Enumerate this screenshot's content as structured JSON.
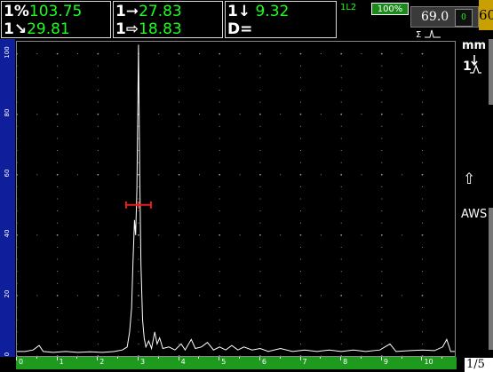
{
  "readings": {
    "r1": {
      "sym": "1%",
      "value": "103.75"
    },
    "r2": {
      "sym": "1↘",
      "value": "29.81"
    },
    "r3": {
      "sym": "1➞",
      "value": "27.83"
    },
    "r4": {
      "sym": "1⇨",
      "value": "18.83"
    },
    "r5": {
      "sym": "1↓",
      "value": "9.32"
    },
    "r6": {
      "label": "D="
    }
  },
  "status": {
    "gate_indicator": "1L2",
    "battery": "100%",
    "gain": "69.0",
    "gain_step_indicator": "0",
    "gain_step": "60",
    "mode_icon": "sigma-rectify-icon"
  },
  "sidebar": {
    "unit": "mm",
    "up_arrow": "⇧",
    "aws": "AWS"
  },
  "page_indicator": "1/5",
  "axes": {
    "y_ticks": [
      "100",
      "80",
      "60",
      "40",
      "20",
      "0"
    ],
    "x_ticks": [
      "0",
      "1",
      "2",
      "3",
      "4",
      "5",
      "6",
      "7",
      "8",
      "9",
      "10"
    ]
  },
  "waveform": {
    "units": "percent screen height vs screen division",
    "x_range": [
      0,
      10.8
    ],
    "y_range": [
      0,
      104
    ],
    "points": [
      [
        0.0,
        1.5
      ],
      [
        0.2,
        1.5
      ],
      [
        0.4,
        2
      ],
      [
        0.55,
        3.5
      ],
      [
        0.65,
        1.5
      ],
      [
        0.9,
        1.2
      ],
      [
        1.2,
        1.5
      ],
      [
        1.5,
        1.2
      ],
      [
        1.8,
        1.4
      ],
      [
        2.1,
        1.2
      ],
      [
        2.4,
        1.5
      ],
      [
        2.6,
        2
      ],
      [
        2.72,
        3
      ],
      [
        2.78,
        8
      ],
      [
        2.83,
        16
      ],
      [
        2.86,
        30
      ],
      [
        2.9,
        45
      ],
      [
        2.93,
        40
      ],
      [
        2.96,
        55
      ],
      [
        3.0,
        103
      ],
      [
        3.03,
        60
      ],
      [
        3.06,
        30
      ],
      [
        3.1,
        12
      ],
      [
        3.14,
        6
      ],
      [
        3.18,
        3
      ],
      [
        3.25,
        5
      ],
      [
        3.32,
        2.5
      ],
      [
        3.4,
        8
      ],
      [
        3.46,
        4
      ],
      [
        3.52,
        6
      ],
      [
        3.6,
        2.5
      ],
      [
        3.75,
        3
      ],
      [
        3.9,
        2
      ],
      [
        4.05,
        4
      ],
      [
        4.15,
        2
      ],
      [
        4.3,
        5.5
      ],
      [
        4.4,
        2.5
      ],
      [
        4.55,
        3
      ],
      [
        4.7,
        4.5
      ],
      [
        4.85,
        2
      ],
      [
        5.0,
        3
      ],
      [
        5.15,
        2
      ],
      [
        5.3,
        3.5
      ],
      [
        5.45,
        2
      ],
      [
        5.6,
        3
      ],
      [
        5.8,
        2
      ],
      [
        6.0,
        2.5
      ],
      [
        6.2,
        1.5
      ],
      [
        6.5,
        2.5
      ],
      [
        6.8,
        1.5
      ],
      [
        7.1,
        2
      ],
      [
        7.4,
        1.5
      ],
      [
        7.7,
        2
      ],
      [
        8.0,
        1.5
      ],
      [
        8.3,
        2
      ],
      [
        8.6,
        1.5
      ],
      [
        8.95,
        2
      ],
      [
        9.2,
        4
      ],
      [
        9.35,
        1.5
      ],
      [
        9.7,
        1.8
      ],
      [
        10.0,
        2
      ],
      [
        10.3,
        1.8
      ],
      [
        10.5,
        3
      ],
      [
        10.6,
        5.5
      ],
      [
        10.7,
        1.5
      ],
      [
        10.8,
        1.5
      ]
    ],
    "gate_marker": {
      "x": 3.0,
      "y": 50
    },
    "colors": {
      "trace": "#ffffff",
      "gate": "#e02020",
      "grid_dot": "#9a9a9a"
    }
  }
}
